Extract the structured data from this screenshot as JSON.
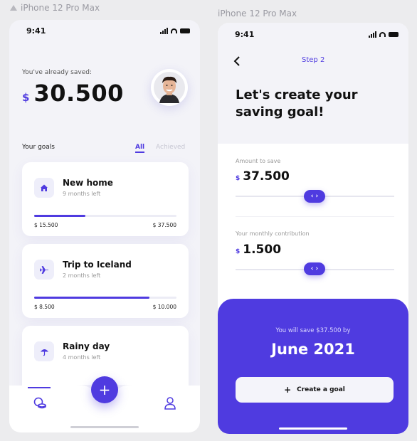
{
  "frames": {
    "left_label": "iPhone 12 Pro Max",
    "right_label": "iPhone 12 Pro Max"
  },
  "colors": {
    "accent": "#4f3be0",
    "background": "#f3f3f8",
    "card": "#ffffff"
  },
  "home_screen": {
    "status_time": "9:41",
    "saved_label": "You've already saved:",
    "currency_symbol": "$",
    "saved_amount": "30.500",
    "goals_title": "Your goals",
    "tabs": [
      {
        "label": "All",
        "active": true
      },
      {
        "label": "Achieved",
        "active": false
      }
    ],
    "goals": [
      {
        "name": "New home",
        "time_left": "9 months left",
        "icon": "home-icon",
        "from": "$ 15.500",
        "to": "$ 37.500",
        "progress": 0.36
      },
      {
        "name": "Trip to Iceland",
        "time_left": "2 months left",
        "icon": "plane-icon",
        "from": "$ 8.500",
        "to": "$ 10.000",
        "progress": 0.81
      },
      {
        "name": "Rainy day",
        "time_left": "4 months left",
        "icon": "umbrella-icon"
      }
    ],
    "fab_label": "+",
    "nav": [
      {
        "icon": "coins-icon",
        "active": true
      },
      {
        "icon": "user-icon",
        "active": false
      }
    ]
  },
  "goal_screen": {
    "status_time": "9:41",
    "back_glyph": "‹",
    "step_label": "Step 2",
    "headline_line1": "Let's create your",
    "headline_line2": "saving goal!",
    "amount_label": "Amount to save",
    "currency_symbol": "$",
    "amount_value": "37.500",
    "contribution_label": "Your monthly contribution",
    "contribution_value": "1.500",
    "slider_glyph": "‹ ›",
    "summary_text": "You will save $37.500 by",
    "target_date": "June 2021",
    "create_button_label": "Create a goal",
    "create_button_icon": "+"
  }
}
